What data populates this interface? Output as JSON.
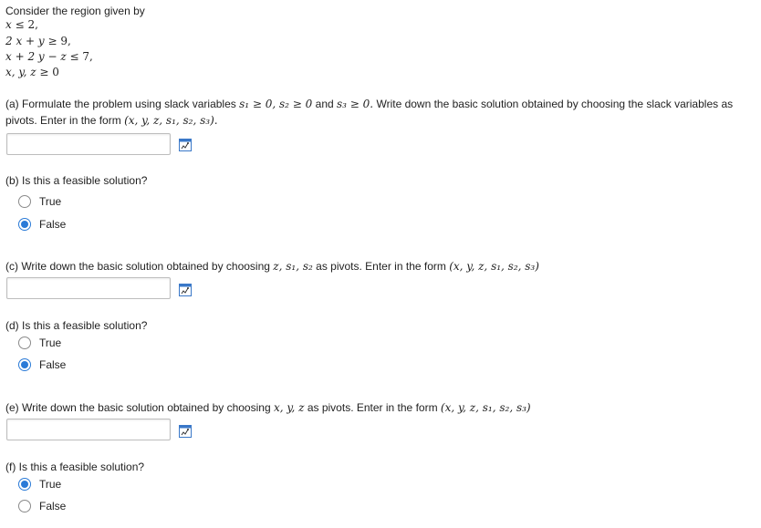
{
  "intro": {
    "text": "Consider the region given by"
  },
  "constraints": [
    {
      "lhs": "x",
      "rel": " ≤ ",
      "rhs": "2,"
    },
    {
      "lhs": "2 x + y",
      "rel": " ≥ ",
      "rhs": "9,"
    },
    {
      "lhs": "x + 2 y − z",
      "rel": " ≤ ",
      "rhs": "7,"
    },
    {
      "lhs": "x, y, z",
      "rel": " ≥ ",
      "rhs": "0"
    }
  ],
  "part_a": {
    "line1_prefix": "(a) Formulate the problem using slack variables ",
    "slack_expr": "s₁ ≥ 0, s₂ ≥ 0",
    "and_text": " and ",
    "s3_expr": "s₃ ≥ 0.",
    "line1_suffix": " Write down the basic solution obtained by choosing the slack variables as",
    "line2_prefix": "pivots. Enter in the form ",
    "form": "(x, y, z, s₁, s₂, s₃).",
    "input_value": ""
  },
  "part_b": {
    "question": "(b) Is this a feasible solution?",
    "options": [
      "True",
      "False"
    ],
    "selected": "False"
  },
  "part_c": {
    "prefix": "(c) Write down the basic solution obtained by choosing ",
    "pivots": "z, s₁, s₂",
    "suffix": " as pivots. Enter in the form ",
    "form": "(x, y, z, s₁, s₂, s₃)",
    "input_value": ""
  },
  "part_d": {
    "question": "(d) Is this a feasible solution?",
    "options": [
      "True",
      "False"
    ],
    "selected": "False"
  },
  "part_e": {
    "prefix": "(e) Write down the basic solution obtained by choosing ",
    "pivots": "x, y, z",
    "suffix": " as pivots. Enter in the form ",
    "form": "(x, y, z, s₁, s₂, s₃)",
    "input_value": ""
  },
  "part_f": {
    "question": "(f) Is this a feasible solution?",
    "options": [
      "True",
      "False"
    ],
    "selected": "True"
  },
  "colors": {
    "radio_accent": "#2a7ad7",
    "icon_accent": "#3a78c8"
  },
  "icons": {
    "preview": "preview-math-icon"
  }
}
